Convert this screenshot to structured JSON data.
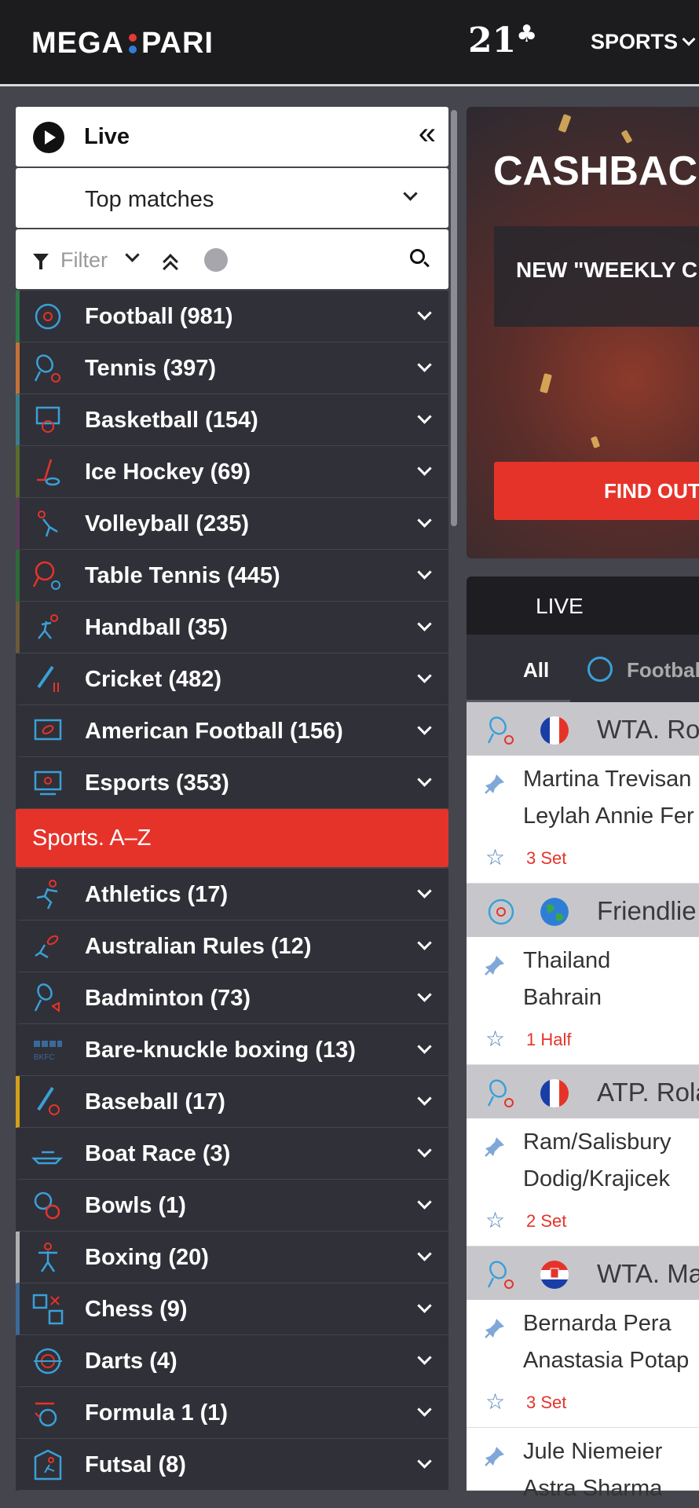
{
  "header": {
    "logo_left": "MEGA",
    "logo_right": "PARI",
    "age_badge": "21",
    "nav_sports": "SPORTS"
  },
  "sidebar": {
    "live_label": "Live",
    "top_matches_label": "Top matches",
    "filter_placeholder": "Filter",
    "top_sports": [
      {
        "label": "Football (981)",
        "color": "#2d7a4a",
        "icon": "football-icon"
      },
      {
        "label": "Tennis (397)",
        "color": "#c4723a",
        "icon": "tennis-icon"
      },
      {
        "label": "Basketball (154)",
        "color": "#3a7e8c",
        "icon": "basketball-icon"
      },
      {
        "label": "Ice Hockey (69)",
        "color": "#5a6a2d",
        "icon": "ice-hockey-icon"
      },
      {
        "label": "Volleyball (235)",
        "color": "#5a3a5a",
        "icon": "volleyball-icon"
      },
      {
        "label": "Table Tennis (445)",
        "color": "#2d6a3a",
        "icon": "table-tennis-icon"
      },
      {
        "label": "Handball (35)",
        "color": "#6a5a3a",
        "icon": "handball-icon"
      },
      {
        "label": "Cricket (482)",
        "color": "transparent",
        "icon": "cricket-icon"
      },
      {
        "label": "American Football (156)",
        "color": "transparent",
        "icon": "american-football-icon"
      },
      {
        "label": "Esports (353)",
        "color": "transparent",
        "icon": "esports-icon"
      }
    ],
    "az_label": "Sports. A–Z",
    "az_sports": [
      {
        "label": "Athletics (17)",
        "color": "transparent",
        "icon": "athletics-icon"
      },
      {
        "label": "Australian Rules (12)",
        "color": "transparent",
        "icon": "australian-rules-icon"
      },
      {
        "label": "Badminton (73)",
        "color": "transparent",
        "icon": "badminton-icon"
      },
      {
        "label": "Bare-knuckle boxing (13)",
        "color": "transparent",
        "icon": "bkfc-icon"
      },
      {
        "label": "Baseball (17)",
        "color": "#d4a017",
        "icon": "baseball-icon"
      },
      {
        "label": "Boat Race (3)",
        "color": "transparent",
        "icon": "boat-race-icon"
      },
      {
        "label": "Bowls (1)",
        "color": "transparent",
        "icon": "bowls-icon"
      },
      {
        "label": "Boxing (20)",
        "color": "#b0b0b0",
        "icon": "boxing-icon"
      },
      {
        "label": "Chess (9)",
        "color": "#3a6a9a",
        "icon": "chess-icon"
      },
      {
        "label": "Darts (4)",
        "color": "transparent",
        "icon": "darts-icon"
      },
      {
        "label": "Formula 1 (1)",
        "color": "transparent",
        "icon": "formula-1-icon"
      },
      {
        "label": "Futsal (8)",
        "color": "transparent",
        "icon": "futsal-icon"
      }
    ]
  },
  "banner": {
    "title": "CASHBAC",
    "box_text": "NEW \"WEEKLY C",
    "cta": "FIND OUT"
  },
  "live_panel": {
    "title": "LIVE",
    "tab_all": "All",
    "tab_football": "Footbal"
  },
  "events": [
    {
      "league": "WTA. Ro",
      "sport_icon": "tennis-icon",
      "flag": "france",
      "team1": "Martina Trevisan",
      "team2": "Leylah Annie Fer",
      "status": "3 Set"
    },
    {
      "league": "Friendlie",
      "sport_icon": "football-icon",
      "flag": "world",
      "team1": "Thailand",
      "team2": "Bahrain",
      "status": "1 Half"
    },
    {
      "league": "ATP. Rola",
      "sport_icon": "tennis-icon",
      "flag": "france",
      "team1": "Ram/Salisbury",
      "team2": "Dodig/Krajicek",
      "status": "2 Set"
    },
    {
      "league": "WTA. Ma",
      "sport_icon": "tennis-icon",
      "flag": "croatia",
      "team1": "Bernarda Pera",
      "team2": "Anastasia Potap",
      "status": "3 Set"
    },
    {
      "league": "",
      "sport_icon": "",
      "flag": "",
      "team1": "Jule Niemeier",
      "team2": "Astra Sharma",
      "status": ""
    }
  ]
}
